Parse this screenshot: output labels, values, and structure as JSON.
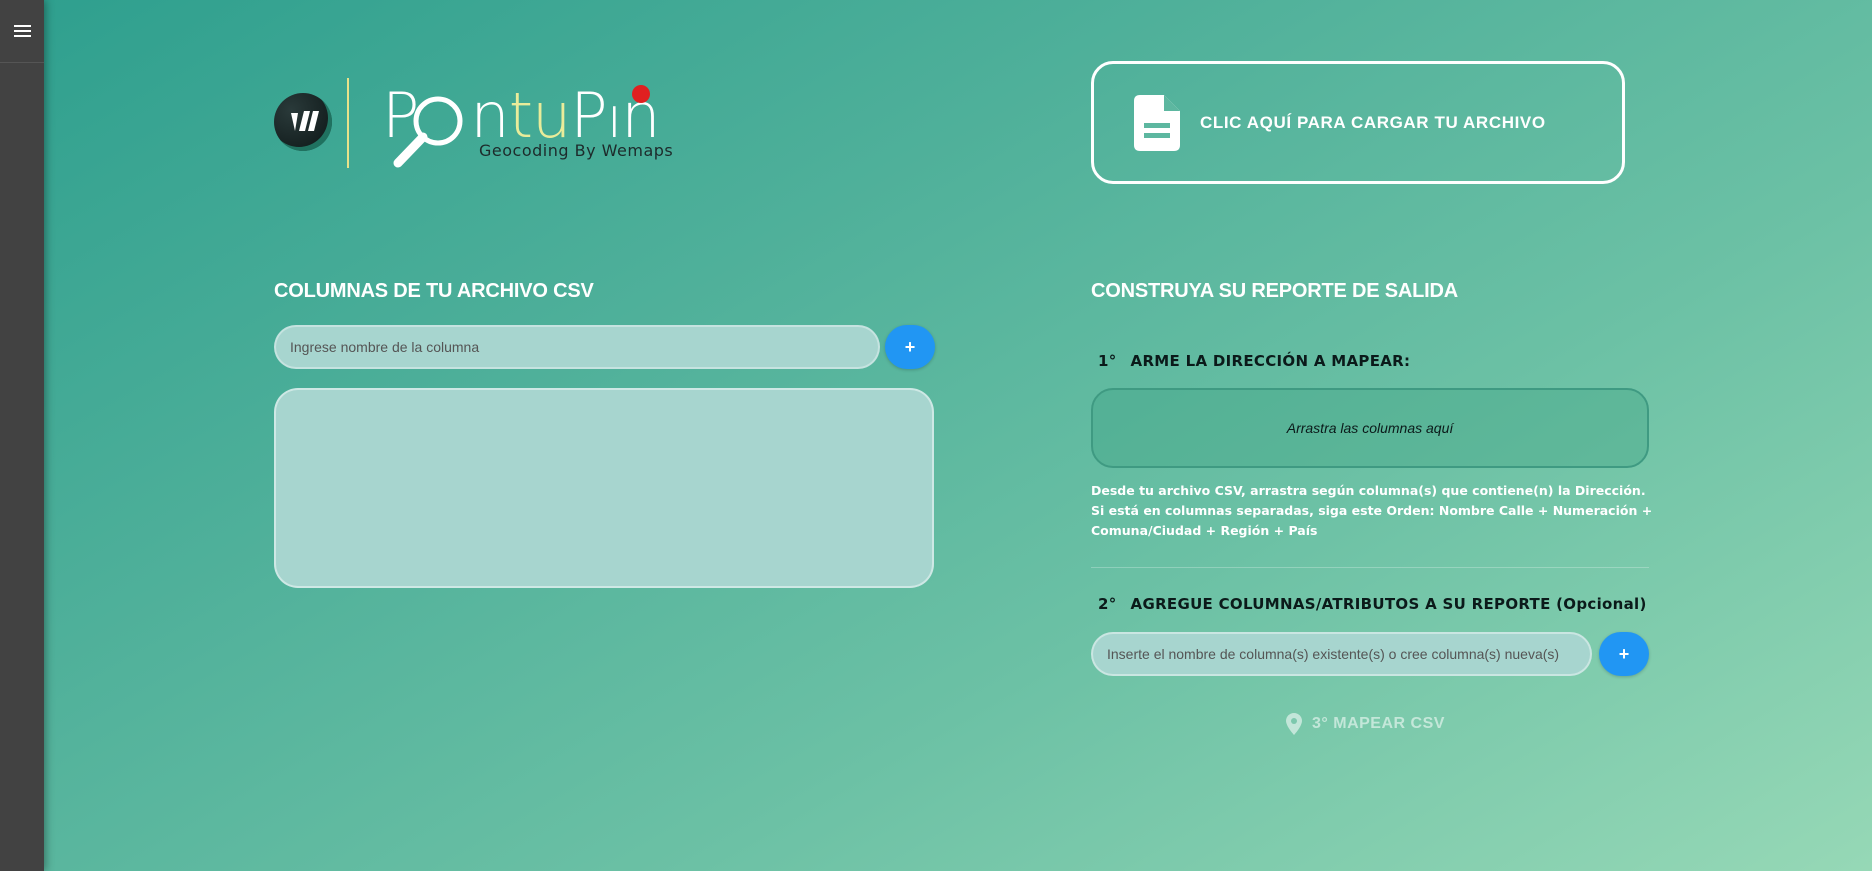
{
  "sidebar": {
    "menu_icon": "hamburger-icon"
  },
  "logo": {
    "word_part1": "P",
    "word_part2": "n",
    "word_highlight": "tu",
    "word_part3": "P",
    "word_part4": "n",
    "tagline": "Geocoding By Wemaps",
    "badge_icon": "wemaps-badge-icon",
    "pin_color": "#e02020",
    "accent_color": "#e9ec9a"
  },
  "upload": {
    "label": "CLIC AQUÍ PARA CARGAR TU ARCHIVO",
    "icon": "file-document-icon"
  },
  "left": {
    "title": "COLUMNAS DE TU ARCHIVO CSV",
    "input_placeholder": "Ingrese nombre de la columna",
    "add_label": "+"
  },
  "right": {
    "title": "CONSTRUYA SU REPORTE DE SALIDA",
    "step1": {
      "num": "1°",
      "label": "ARME LA DIRECCIÓN A MAPEAR:"
    },
    "dropzone_text": "Arrastra las columnas aquí",
    "help": "Desde tu archivo CSV, arrastra según columna(s) que contiene(n) la Dirección. Si está en columnas separadas, siga este Orden: Nombre Calle + Numeración + Comuna/Ciudad + Región + País",
    "step2": {
      "num": "2°",
      "label": "AGREGUE COLUMNAS/ATRIBUTOS A SU REPORTE (Opcional)"
    },
    "attr_placeholder": "Inserte el nombre de columna(s) existente(s) o cree columna(s) nueva(s)",
    "add_label": "+",
    "map_button": "3° MAPEAR CSV",
    "map_icon": "map-pin-icon"
  },
  "colors": {
    "primary_button": "#2196f3",
    "sidebar": "#424242"
  }
}
